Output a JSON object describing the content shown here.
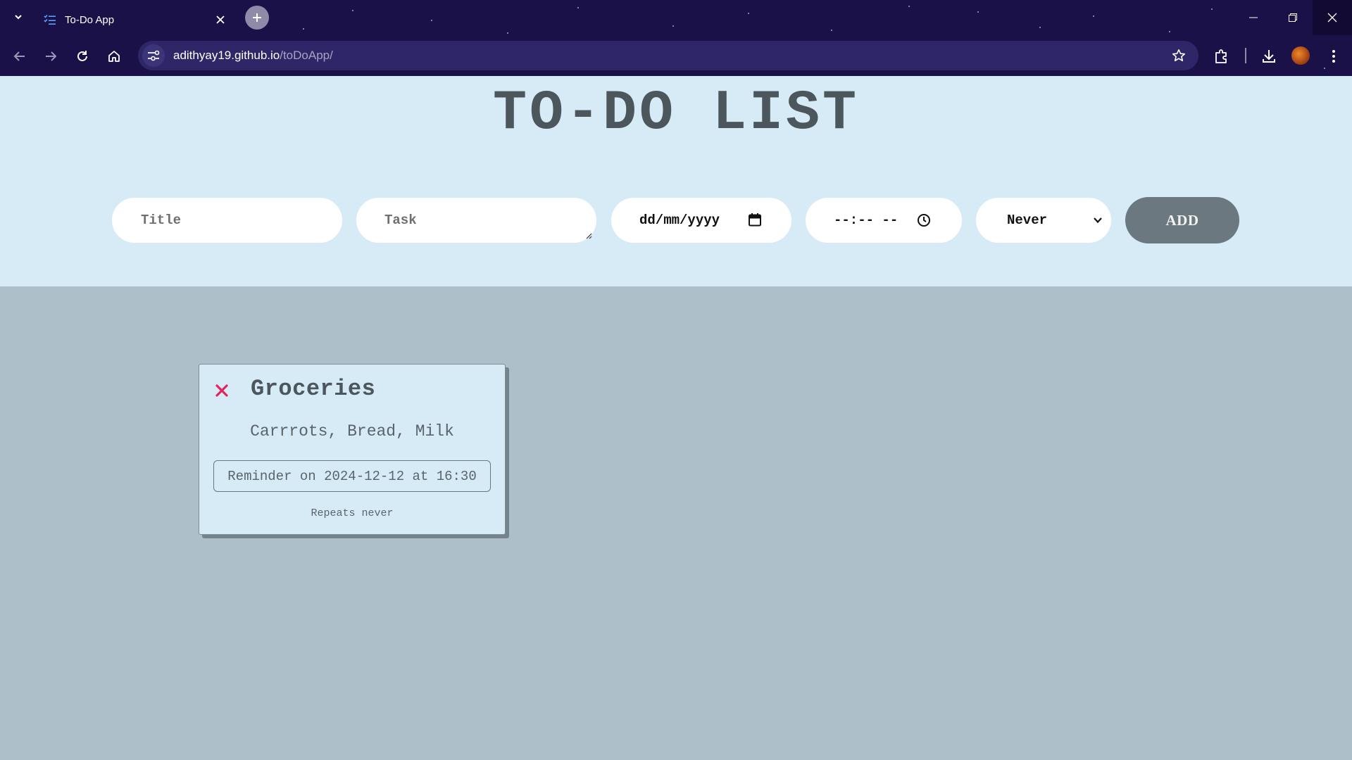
{
  "browser": {
    "tab_title": "To-Do App",
    "url_host": "adithyay19.github.io",
    "url_path": "/toDoApp/"
  },
  "page": {
    "title": "TO-DO LIST"
  },
  "form": {
    "title_placeholder": "Title",
    "task_placeholder": "Task",
    "date_placeholder": "dd/mm/yyyy",
    "time_placeholder": "--:-- --",
    "repeat_selected": "Never",
    "add_label": "ADD"
  },
  "tasks": [
    {
      "title": "Groceries",
      "body": "Carrrots, Bread, Milk",
      "reminder": "Reminder on 2024-12-12 at 16:30",
      "repeat": "Repeats never"
    }
  ],
  "colors": {
    "chrome_bg": "#1b1149",
    "header_bg": "#d7ebf7",
    "page_bg": "#adbfc8",
    "add_button": "#6b7880",
    "delete_accent": "#e0245e",
    "title_text": "#4b565d"
  }
}
